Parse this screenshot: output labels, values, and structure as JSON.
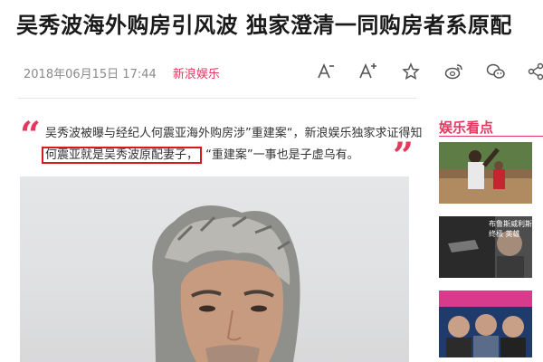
{
  "article": {
    "title": "吴秀波海外购房引风波 独家澄清一同购房者系原配",
    "date": "2018年06月15日 17:44",
    "channel": "新浪娱乐",
    "summary_line1": "吴秀波被曝与经纪人何震亚海外购房涉”重建案“，新浪娱乐独家求证得知",
    "summary_highlight": "何震亚就是吴秀波原配妻子，",
    "summary_line2_rest": "“重建案”一事也是子虚乌有。"
  },
  "toolbar": {
    "icons": [
      "font-decrease-icon",
      "font-increase-icon",
      "star-icon",
      "weibo-icon",
      "wechat-icon",
      "share-icon"
    ]
  },
  "sidebar": {
    "title": "娱乐看点",
    "thumb2_caption": "布鲁斯威利斯 终极 英雄"
  },
  "colors": {
    "accent": "#e23a5f",
    "highlight_box": "#d7191c"
  }
}
